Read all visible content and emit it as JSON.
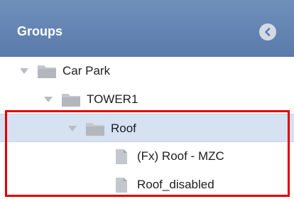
{
  "header": {
    "title": "Groups",
    "collapse_icon": "chevron-left-circle-icon"
  },
  "tree": {
    "items": [
      {
        "label": "Car Park",
        "type": "folder",
        "expanded": true,
        "selected": false
      },
      {
        "label": "TOWER1",
        "type": "folder",
        "expanded": true,
        "selected": false
      },
      {
        "label": "Roof",
        "type": "folder",
        "expanded": true,
        "selected": true
      },
      {
        "label": "(Fx) Roof - MZC",
        "type": "file",
        "selected": false
      },
      {
        "label": "Roof_disabled",
        "type": "file",
        "selected": false
      }
    ]
  },
  "colors": {
    "header_bg": "#5f80af",
    "selected_row_bg": "#d6e1f2",
    "highlight_border": "#e00000"
  }
}
